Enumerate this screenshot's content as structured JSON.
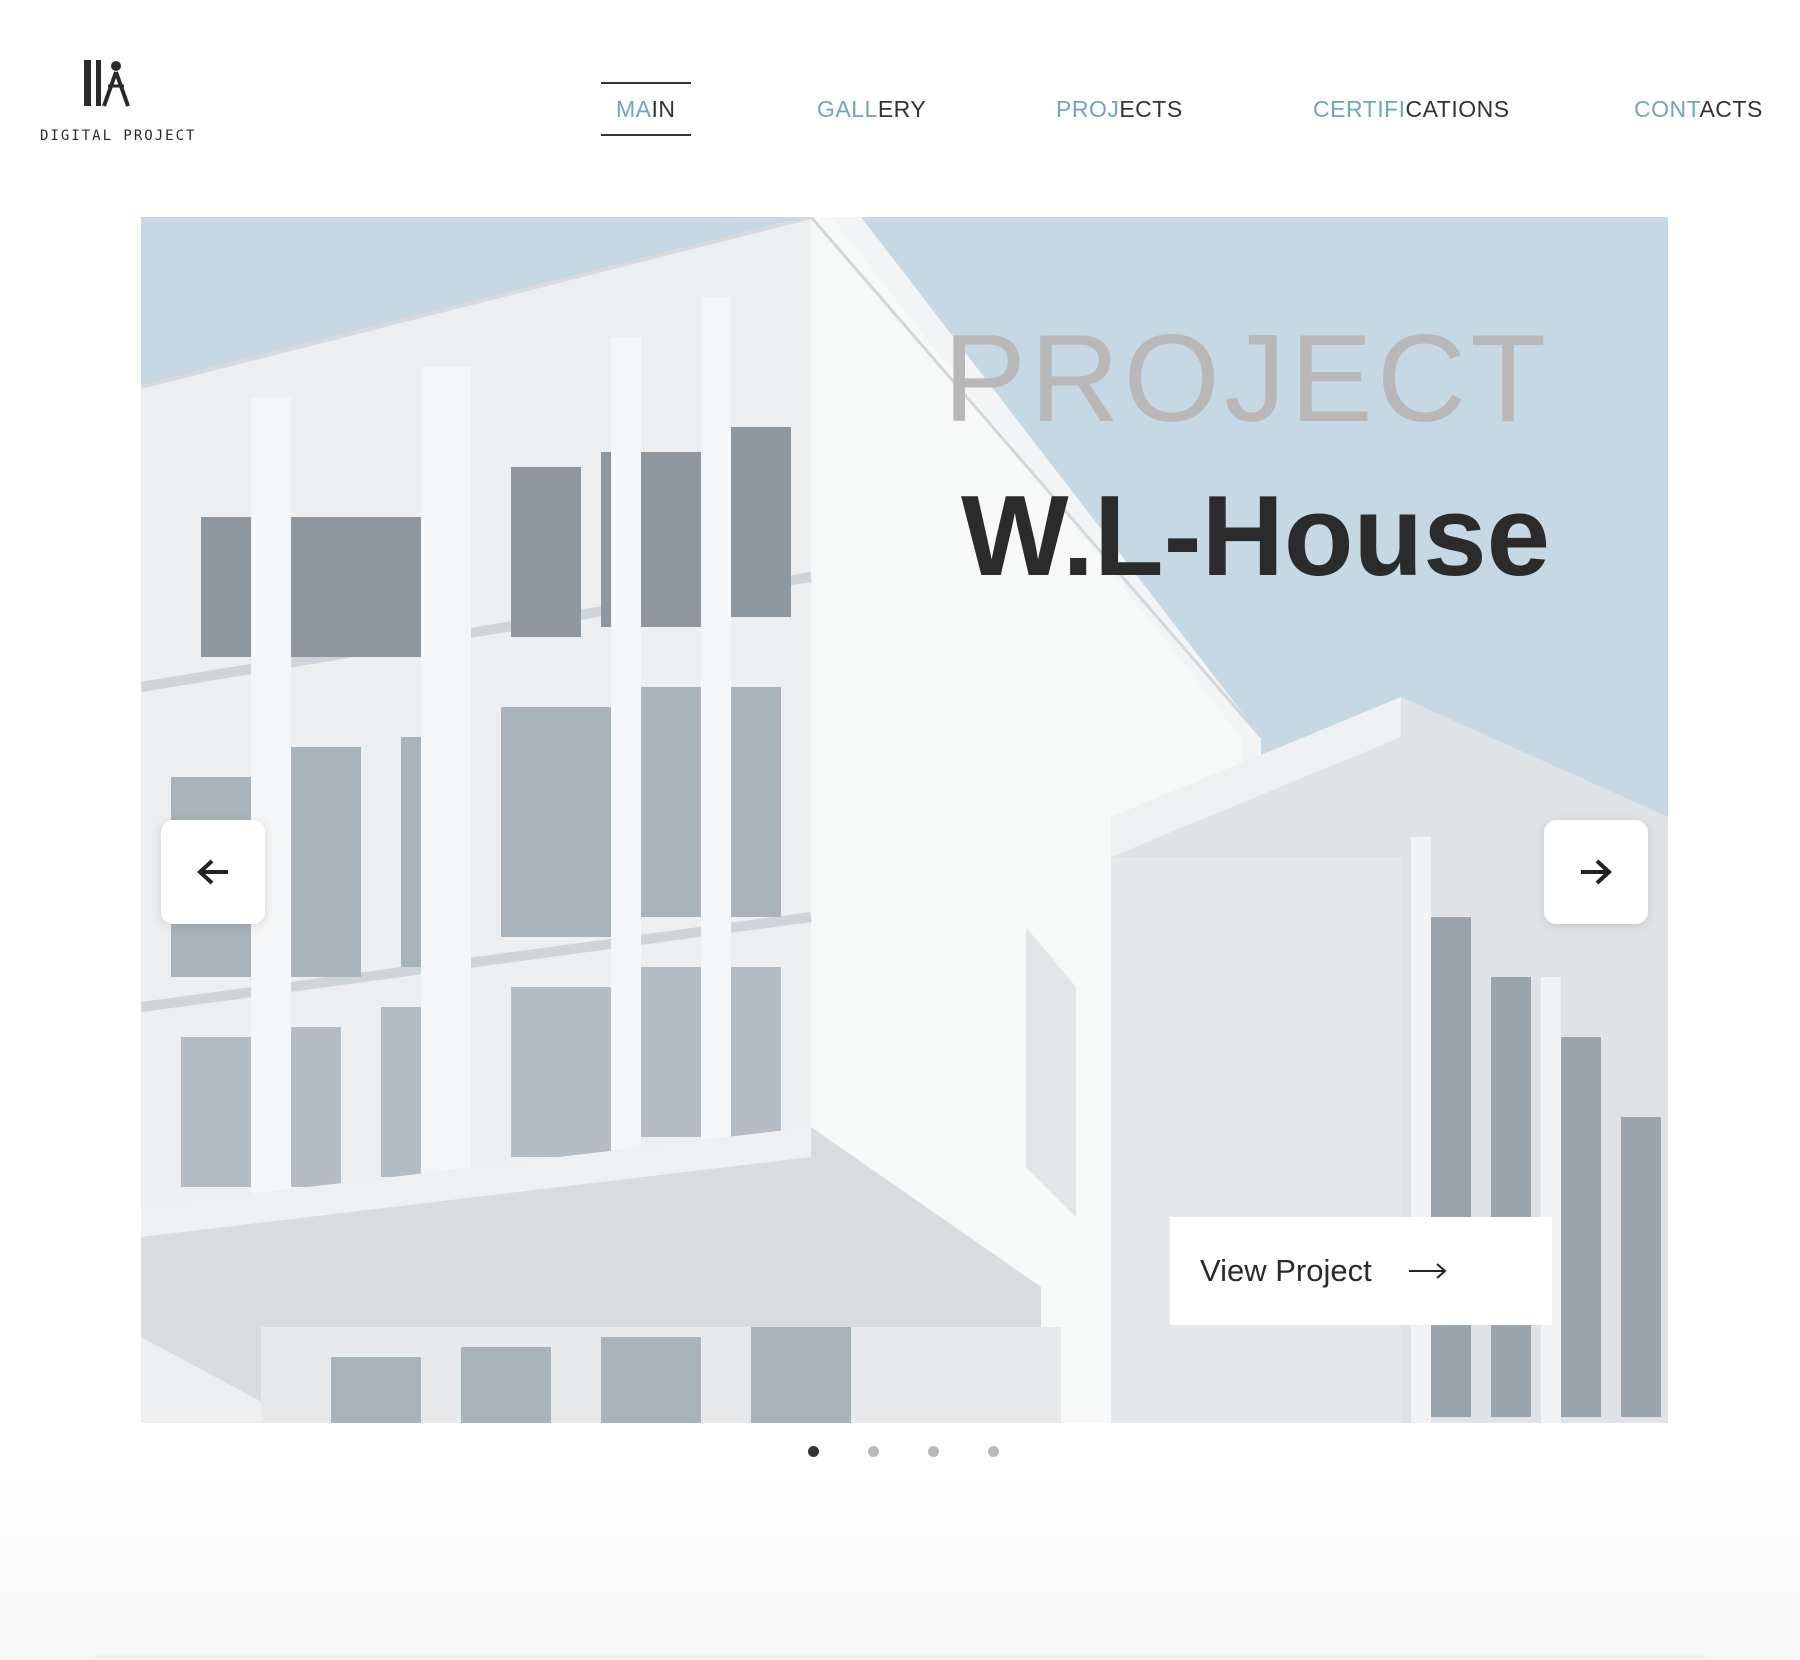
{
  "brand": {
    "logo_text": "DIGITAL PROJECT",
    "logo_icon": "compass-pencils-logo"
  },
  "nav": {
    "items": [
      {
        "accent": "MA",
        "rest": "IN",
        "active": true
      },
      {
        "accent": "GALL",
        "rest": "ERY",
        "active": false
      },
      {
        "accent": "PROJ",
        "rest": "ECTS",
        "active": false
      },
      {
        "accent": "CERTIFI",
        "rest": "CATIONS",
        "active": false
      },
      {
        "accent": "CONT",
        "rest": "ACTS",
        "active": false
      }
    ]
  },
  "hero": {
    "kicker": "PROJECT",
    "title": "W.L-House",
    "cta_label": "View Project",
    "prev_icon": "arrow-left-icon",
    "next_icon": "arrow-right-icon",
    "cta_icon": "long-arrow-right-icon"
  },
  "slider": {
    "slide_count": 4,
    "active_slide": 1
  },
  "colors": {
    "accent": "#6ea5c4",
    "text": "#333333",
    "sky": "#c5d8e3",
    "kicker": "#b8b8b8",
    "dot_active": "#333333",
    "dot_inactive": "#b9b9b9"
  }
}
